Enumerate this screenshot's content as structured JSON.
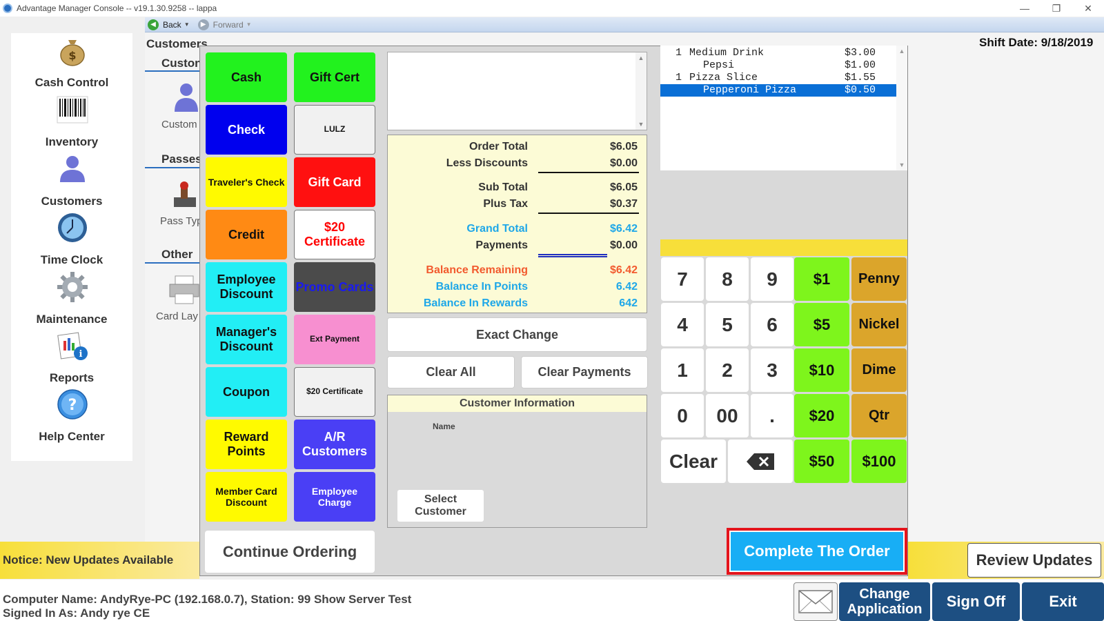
{
  "window": {
    "title": "Advantage Manager Console -- v19.1.30.9258 -- lappa",
    "minimize": "—",
    "restore": "❐",
    "close": "✕"
  },
  "nav": {
    "back": "Back",
    "forward": "Forward"
  },
  "sidebar": {
    "items": [
      {
        "label": "Cash Control",
        "icon": "money-bag-icon"
      },
      {
        "label": "Inventory",
        "icon": "barcode-icon"
      },
      {
        "label": "Customers",
        "icon": "person-icon"
      },
      {
        "label": "Time Clock",
        "icon": "clock-icon"
      },
      {
        "label": "Maintenance",
        "icon": "gear-icon"
      },
      {
        "label": "Reports",
        "icon": "reports-icon"
      },
      {
        "label": "Help Center",
        "icon": "help-icon"
      }
    ]
  },
  "behind": {
    "breadcrumb": "Customers",
    "section1": "Custon",
    "item1": "Custom",
    "section2": "Passes",
    "item2": "Pass Typ",
    "section3": "Other",
    "item3": "Card Lay",
    "shift_date": "Shift Date: 9/18/2019"
  },
  "payments": {
    "left": [
      {
        "label": "Cash",
        "bg": "#22f21e",
        "fg": "#111111"
      },
      {
        "label": "Check",
        "bg": "#0000ee",
        "fg": "#ffffff"
      },
      {
        "label": "Traveler's Check",
        "bg": "#fffa00",
        "fg": "#111111",
        "small": true
      },
      {
        "label": "Credit",
        "bg": "#ff8a14",
        "fg": "#111111"
      },
      {
        "label": "Employee Discount",
        "bg": "#22eef5",
        "fg": "#111111"
      },
      {
        "label": "Manager's Discount",
        "bg": "#22eef5",
        "fg": "#111111"
      },
      {
        "label": "Coupon",
        "bg": "#22eef5",
        "fg": "#111111"
      },
      {
        "label": "Reward Points",
        "bg": "#fffa00",
        "fg": "#111111"
      },
      {
        "label": "Member Card Discount",
        "bg": "#fffa00",
        "fg": "#111111",
        "small": true
      }
    ],
    "right": [
      {
        "label": "Gift Cert",
        "bg": "#22f21e",
        "fg": "#111111"
      },
      {
        "label": "LULZ",
        "bg": "#f1f1f1",
        "fg": "#111111",
        "tiny": true
      },
      {
        "label": "Gift Card",
        "bg": "#ff1010",
        "fg": "#ffffff"
      },
      {
        "label": "$20 Certificate",
        "bg": "#ffffff",
        "fg": "#ff0000"
      },
      {
        "label": "Promo Cards",
        "bg": "#4b4b4b",
        "fg": "#1a1af0"
      },
      {
        "label": "Ext Payment",
        "bg": "#f78fd0",
        "fg": "#111111",
        "tiny": true
      },
      {
        "label": "$20 Certificate",
        "bg": "#f1f1f1",
        "fg": "#111111",
        "tiny": true
      },
      {
        "label": "A/R Customers",
        "bg": "#4a3ff5",
        "fg": "#ffffff"
      },
      {
        "label": "Employee Charge",
        "bg": "#4a3ff5",
        "fg": "#ffffff",
        "small": true
      }
    ]
  },
  "summary": {
    "order_total_label": "Order Total",
    "order_total": "$6.05",
    "less_discounts_label": "Less Discounts",
    "less_discounts": "$0.00",
    "sub_total_label": "Sub Total",
    "sub_total": "$6.05",
    "plus_tax_label": "Plus Tax",
    "plus_tax": "$0.37",
    "grand_total_label": "Grand Total",
    "grand_total": "$6.42",
    "payments_label": "Payments",
    "payments": "$0.00",
    "balance_remaining_label": "Balance Remaining",
    "balance_remaining": "$6.42",
    "balance_points_label": "Balance In Points",
    "balance_points": "6.42",
    "balance_rewards_label": "Balance In Rewards",
    "balance_rewards": "642"
  },
  "actions": {
    "exact_change": "Exact Change",
    "clear_all": "Clear All",
    "clear_payments": "Clear Payments"
  },
  "customer_info": {
    "title": "Customer Information",
    "name_label": "Name",
    "select_customer": "Select Customer"
  },
  "receipt": [
    {
      "qty": "1",
      "item": "Medium Drink",
      "price": "$3.00",
      "mod": false,
      "selected": false
    },
    {
      "qty": "",
      "item": "Pepsi",
      "price": "$1.00",
      "mod": true,
      "selected": false
    },
    {
      "qty": "1",
      "item": "Pizza Slice",
      "price": "$1.55",
      "mod": false,
      "selected": false
    },
    {
      "qty": "",
      "item": "Pepperoni Pizza",
      "price": "$0.50",
      "mod": true,
      "selected": true
    }
  ],
  "keypad": {
    "rows": [
      [
        "7",
        "8",
        "9"
      ],
      [
        "4",
        "5",
        "6"
      ],
      [
        "1",
        "2",
        "3"
      ],
      [
        "0",
        "00",
        "."
      ]
    ],
    "clear": "Clear",
    "bills": [
      "$1",
      "$5",
      "$10",
      "$20",
      "$50",
      "$100"
    ],
    "coins": [
      "Penny",
      "Nickel",
      "Dime",
      "Qtr"
    ]
  },
  "continue_ordering": "Continue Ordering",
  "complete_order": "Complete The Order",
  "notice": "Notice: New Updates Available",
  "review_updates": "Review Updates",
  "status": {
    "computer": "Computer Name: AndyRye-PC (192.168.0.7), Station: 99 Show Server Test",
    "signed_in": "Signed In As: Andy rye CE"
  },
  "footer": {
    "change_application": "Change Application",
    "sign_off": "Sign Off",
    "exit": "Exit"
  },
  "colors": {
    "accent_blue": "#1d4f82",
    "complete_blue": "#18aef5",
    "highlight_red": "#e4141c",
    "notice_yellow": "#f7df3a",
    "summary_bg": "#fcfbd6",
    "bill_green": "#7ef51c",
    "coin_gold": "#dba52b"
  }
}
